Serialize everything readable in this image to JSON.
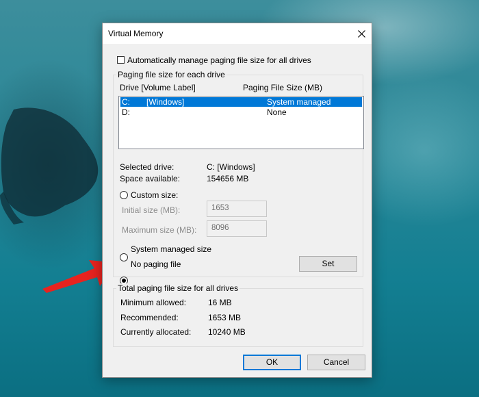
{
  "dialog": {
    "title": "Virtual Memory",
    "auto_manage_label": "Automatically manage paging file size for all drives",
    "auto_manage_checked": false
  },
  "drives_group": {
    "title": "Paging file size for each drive",
    "col_drive": "Drive  [Volume Label]",
    "col_size": "Paging File Size (MB)",
    "rows": [
      {
        "drive": "C:",
        "label": "[Windows]",
        "size": "System managed",
        "selected": true
      },
      {
        "drive": "D:",
        "label": "",
        "size": "None",
        "selected": false
      }
    ],
    "selected_drive_label": "Selected drive:",
    "selected_drive_value": "C:  [Windows]",
    "space_available_label": "Space available:",
    "space_available_value": "154656 MB",
    "custom_size_label": "Custom size:",
    "initial_size_label": "Initial size (MB):",
    "initial_size_value": "1653",
    "maximum_size_label": "Maximum size (MB):",
    "maximum_size_value": "8096",
    "system_managed_label": "System managed size",
    "no_paging_label": "No paging file",
    "selected_option": "no_paging",
    "set_label": "Set"
  },
  "totals_group": {
    "title": "Total paging file size for all drives",
    "min_label": "Minimum allowed:",
    "min_value": "16 MB",
    "rec_label": "Recommended:",
    "rec_value": "1653 MB",
    "cur_label": "Currently allocated:",
    "cur_value": "10240 MB"
  },
  "buttons": {
    "ok": "OK",
    "cancel": "Cancel"
  },
  "colors": {
    "selection": "#0078d7",
    "arrow": "#e8231f"
  }
}
